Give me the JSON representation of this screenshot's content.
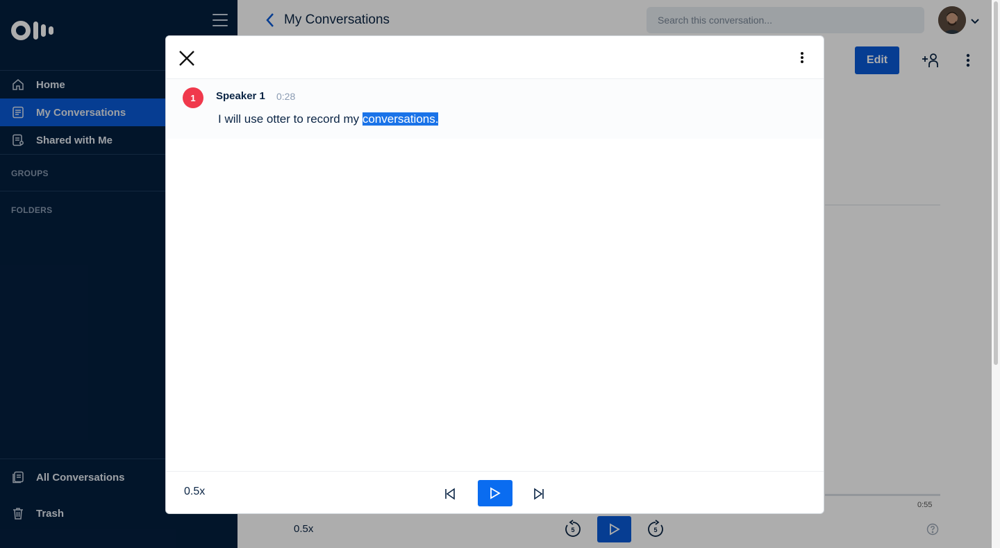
{
  "sidebar": {
    "nav": [
      {
        "label": "Home",
        "icon": "home-icon"
      },
      {
        "label": "My Conversations",
        "icon": "conversations-icon",
        "active": true
      },
      {
        "label": "Shared with Me",
        "icon": "shared-icon"
      }
    ],
    "groups_label": "GROUPS",
    "folders_label": "FOLDERS",
    "bottom": [
      {
        "label": "All Conversations",
        "icon": "all-conversations-icon"
      },
      {
        "label": "Trash",
        "icon": "trash-icon"
      }
    ]
  },
  "header": {
    "title": "My Conversations",
    "search_placeholder": "Search this conversation..."
  },
  "toolbar": {
    "edit_label": "Edit"
  },
  "background_player": {
    "speed": "0.5x",
    "duration": "0:55",
    "rewind_seconds": "5",
    "forward_seconds": "5"
  },
  "modal": {
    "segment": {
      "speaker_number": "1",
      "speaker_name": "Speaker 1",
      "timestamp": "0:28",
      "text_before": "I will use otter to record my ",
      "text_highlighted": "conversations."
    },
    "player": {
      "speed": "0.5x"
    }
  },
  "colors": {
    "sidebar_bg": "#041f3f",
    "accent": "#0a5ad8",
    "speaker_badge": "#f0394c",
    "highlight": "#1a73e8"
  }
}
